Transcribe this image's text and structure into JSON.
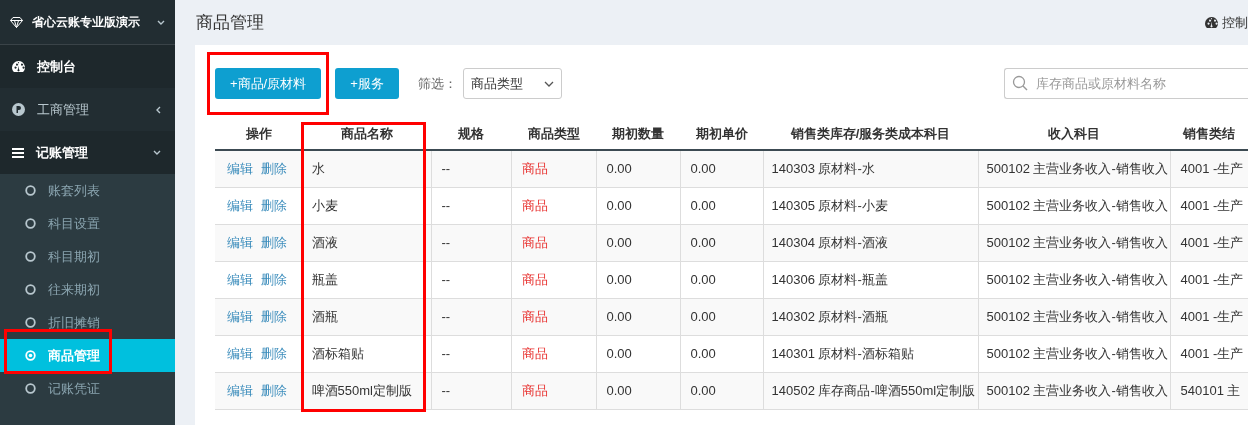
{
  "sidebar": {
    "brand": "省心云账专业版演示",
    "items": [
      {
        "kind": "top",
        "label": "控制台"
      },
      {
        "kind": "group",
        "label": "工商管理",
        "expanded": false
      },
      {
        "kind": "group",
        "label": "记账管理",
        "expanded": true,
        "children": [
          {
            "label": "账套列表",
            "selected": false,
            "highlighted": false
          },
          {
            "label": "科目设置",
            "selected": false,
            "highlighted": false
          },
          {
            "label": "科目期初",
            "selected": false,
            "highlighted": false
          },
          {
            "label": "往来期初",
            "selected": false,
            "highlighted": false
          },
          {
            "label": "折旧摊销",
            "selected": false,
            "highlighted": false
          },
          {
            "label": "商品管理",
            "selected": true,
            "highlighted": true
          },
          {
            "label": "记账凭证",
            "selected": false,
            "highlighted": false
          }
        ]
      }
    ]
  },
  "header": {
    "title": "商品管理",
    "link": "控制"
  },
  "toolbar": {
    "buttons": [
      {
        "label": "+商品/原材料",
        "highlighted": true
      },
      {
        "label": "+服务",
        "highlighted": false
      }
    ],
    "filter_label": "筛选：",
    "filter_value": "商品类型",
    "search": {
      "placeholder": "库存商品或原材料名称"
    }
  },
  "table": {
    "columns": [
      {
        "label": "操作",
        "highlighted": false
      },
      {
        "label": "商品名称",
        "highlighted": true
      },
      {
        "label": "规格",
        "highlighted": false
      },
      {
        "label": "商品类型",
        "highlighted": false
      },
      {
        "label": "期初数量",
        "highlighted": false
      },
      {
        "label": "期初单价",
        "highlighted": false
      },
      {
        "label": "销售类库存/服务类成本科目",
        "highlighted": false
      },
      {
        "label": "收入科目",
        "highlighted": false
      },
      {
        "label": "销售类结",
        "highlighted": false
      }
    ],
    "rows": [
      {
        "cells": [
          [
            "编辑",
            "删除"
          ],
          "水",
          "--",
          "商品",
          "0.00",
          "0.00",
          "140303 原材料-水",
          "500102 主营业务收入-销售收入",
          "4001 -生产"
        ]
      },
      {
        "cells": [
          [
            "编辑",
            "删除"
          ],
          "小麦",
          "--",
          "商品",
          "0.00",
          "0.00",
          "140305 原材料-小麦",
          "500102 主营业务收入-销售收入",
          "4001 -生产"
        ]
      },
      {
        "cells": [
          [
            "编辑",
            "删除"
          ],
          "酒液",
          "--",
          "商品",
          "0.00",
          "0.00",
          "140304 原材料-酒液",
          "500102 主营业务收入-销售收入",
          "4001 -生产"
        ]
      },
      {
        "cells": [
          [
            "编辑",
            "删除"
          ],
          "瓶盖",
          "--",
          "商品",
          "0.00",
          "0.00",
          "140306 原材料-瓶盖",
          "500102 主营业务收入-销售收入",
          "4001 -生产"
        ]
      },
      {
        "cells": [
          [
            "编辑",
            "删除"
          ],
          "酒瓶",
          "--",
          "商品",
          "0.00",
          "0.00",
          "140302 原材料-酒瓶",
          "500102 主营业务收入-销售收入",
          "4001 -生产"
        ]
      },
      {
        "cells": [
          [
            "编辑",
            "删除"
          ],
          "酒标箱贴",
          "--",
          "商品",
          "0.00",
          "0.00",
          "140301 原材料-酒标箱贴",
          "500102 主营业务收入-销售收入",
          "4001 -生产"
        ]
      },
      {
        "cells": [
          [
            "编辑",
            "删除"
          ],
          "啤酒550ml定制版",
          "--",
          "商品",
          "0.00",
          "0.00",
          "140502 库存商品-啤酒550ml定制版",
          "500102 主营业务收入-销售收入",
          "540101 主"
        ]
      }
    ]
  }
}
